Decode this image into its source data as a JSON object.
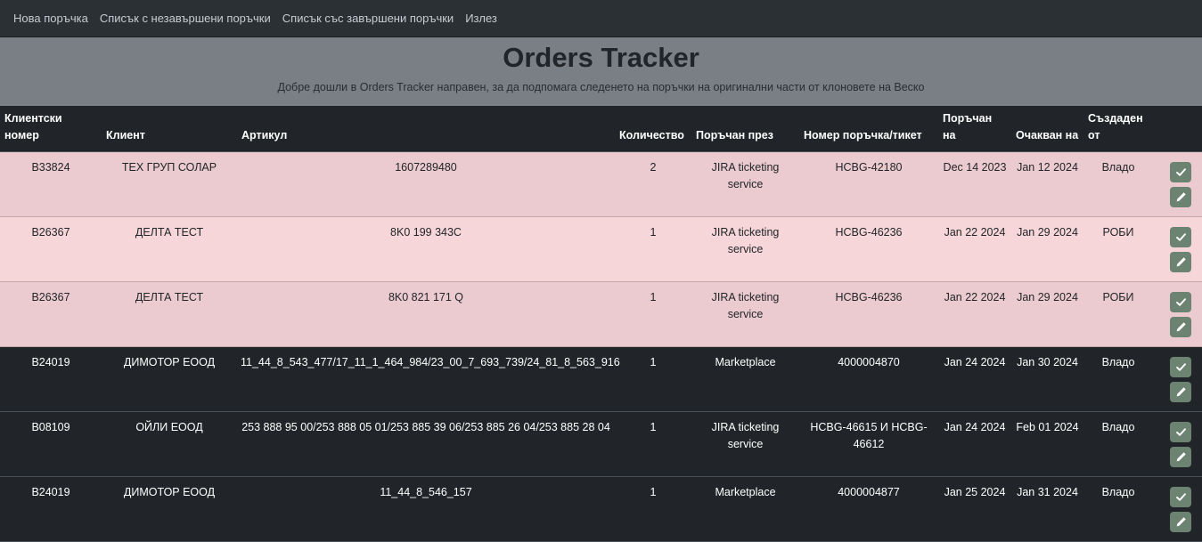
{
  "nav": {
    "items": [
      "Нова поръчка",
      "Списък с незавършени поръчки",
      "Списък със завършени поръчки",
      "Излез"
    ]
  },
  "header": {
    "title": "Orders Tracker",
    "subtitle": "Добре дошли в Orders Tracker направен, за да подпомага следенето на поръчки на оригинални части от клоновете на Веско"
  },
  "table": {
    "columns": {
      "client_number": "Клиентски номер",
      "client": "Клиент",
      "article": "Артикул",
      "quantity": "Количество",
      "ordered_via": "Поръчан през",
      "order_number": "Номер поръчка/тикет",
      "ordered_on": "Поръчан на",
      "expected_on": "Очакван на",
      "created_by": "Създаден от"
    },
    "rows": [
      {
        "client_number": "B33824",
        "client": "ТЕХ ГРУП СОЛАР",
        "article": "1607289480",
        "quantity": "2",
        "ordered_via": "JIRA ticketing service",
        "order_number": "HCBG-42180",
        "ordered_on": "Dec 14 2023",
        "expected_on": "Jan 12 2024",
        "created_by": "Владо",
        "status": "pending"
      },
      {
        "client_number": "B26367",
        "client": "ДЕЛТА ТЕСТ",
        "article": "8K0 199 343C",
        "quantity": "1",
        "ordered_via": "JIRA ticketing service",
        "order_number": "HCBG-46236",
        "ordered_on": "Jan 22 2024",
        "expected_on": "Jan 29 2024",
        "created_by": "РОБИ",
        "status": "pending"
      },
      {
        "client_number": "B26367",
        "client": "ДЕЛТА ТЕСТ",
        "article": "8K0 821 171 Q",
        "quantity": "1",
        "ordered_via": "JIRA ticketing service",
        "order_number": "HCBG-46236",
        "ordered_on": "Jan 22 2024",
        "expected_on": "Jan 29 2024",
        "created_by": "РОБИ",
        "status": "pending"
      },
      {
        "client_number": "B24019",
        "client": "ДИМОТОР ЕООД",
        "article": "11_44_8_543_477/17_11_1_464_984/23_00_7_693_739/24_81_8_563_916",
        "quantity": "1",
        "ordered_via": "Marketplace",
        "order_number": "4000004870",
        "ordered_on": "Jan 24 2024",
        "expected_on": "Jan 30 2024",
        "created_by": "Владо",
        "status": "normal"
      },
      {
        "client_number": "B08109",
        "client": "ОЙЛИ ЕООД",
        "article": "253 888 95 00/253 888 05 01/253 885 39 06/253 885 26 04/253 885 28 04",
        "quantity": "1",
        "ordered_via": "JIRA ticketing service",
        "order_number": "HCBG-46615 И HCBG-46612",
        "ordered_on": "Jan 24 2024",
        "expected_on": "Feb 01 2024",
        "created_by": "Владо",
        "status": "normal"
      },
      {
        "client_number": "B24019",
        "client": "ДИМОТОР ЕООД",
        "article": "11_44_8_546_157",
        "quantity": "1",
        "ordered_via": "Marketplace",
        "order_number": "4000004877",
        "ordered_on": "Jan 25 2024",
        "expected_on": "Jan 31 2024",
        "created_by": "Владо",
        "status": "normal"
      }
    ]
  },
  "colors": {
    "pending_row_a": "#ebcbcf",
    "pending_row_b": "#f6d6d9",
    "dark_row": "#212529",
    "action_button": "#6c8371"
  },
  "icons": {
    "complete": "check-icon",
    "edit": "pencil-icon"
  }
}
